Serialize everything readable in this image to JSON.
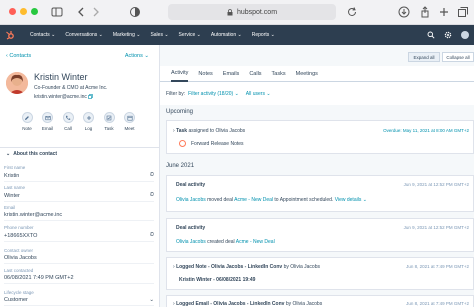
{
  "browser": {
    "url": "hubspot.com"
  },
  "nav": {
    "items": [
      "Contacts",
      "Conversations",
      "Marketing",
      "Sales",
      "Service",
      "Automation",
      "Reports"
    ]
  },
  "left": {
    "back_label": "Contacts",
    "actions_label": "Actions",
    "contact": {
      "name": "Kristin Winter",
      "role": "Co-Founder & CMO at Acme Inc.",
      "email": "kristin.winter@acme.inc"
    },
    "actions": [
      "Note",
      "Email",
      "Call",
      "Log",
      "Task",
      "Meet"
    ],
    "section_title": "About this contact",
    "props": [
      {
        "label": "First name",
        "value": "Kristin"
      },
      {
        "label": "Last name",
        "value": "Winter"
      },
      {
        "label": "Email",
        "value": "kristin.winter@acme.inc"
      },
      {
        "label": "Phone number",
        "value": "+18665XXTO"
      },
      {
        "label": "Contact owner",
        "value": "Olivia Jacobs"
      },
      {
        "label": "Last contacted",
        "value": "06/08/2021 7:49 PM GMT+2"
      },
      {
        "label": "Lifecycle stage",
        "value": "Customer"
      }
    ]
  },
  "right": {
    "expand_all": "Expand all",
    "collapse_all": "Collapse all",
    "tabs": [
      "Activity",
      "Notes",
      "Emails",
      "Calls",
      "Tasks",
      "Meetings"
    ],
    "filter": {
      "label": "Filter by:",
      "activity": "Filter activity (18/20)",
      "users": "All users"
    },
    "upcoming": "Upcoming",
    "task": {
      "prefix": "Task",
      "text": "assigned to Olivia Jacobs",
      "date": "Overdue: May 11, 2021 at 8:00 AM GMT+2",
      "title": "Forward Release Notes"
    },
    "month": "June 2021",
    "deal1": {
      "title": "Deal activity",
      "date": "Jun 9, 2021 at 12:52 PM GMT+2",
      "actor": "Olivia Jacobs",
      "verb": "moved deal",
      "deal": "Acme - New Deal",
      "rest": "to Appointment scheduled.",
      "details": "View details"
    },
    "deal2": {
      "title": "Deal activity",
      "date": "Jun 9, 2021 at 12:52 PM GMT+2",
      "actor": "Olivia Jacobs",
      "verb": "created deal",
      "deal": "Acme - New Deal"
    },
    "note": {
      "prefix": "Logged Note - Olivia Jacobs - LinkedIn Conv",
      "by": "by Olivia Jacobs",
      "date": "Jun 8, 2021 at 7:49 PM GMT+2",
      "body": "Kristin Winter - 06/08/2021 19:49"
    },
    "email": {
      "prefix": "Logged Email - Olivia Jacobs - LinkedIn Conv",
      "by": "by Olivia Jacobs",
      "date": "Jun 8, 2021 at 7:49 PM GMT+2"
    }
  },
  "colors": {
    "nav": "#2d3e50",
    "accent": "#ff7a59",
    "link": "#0091ae"
  }
}
